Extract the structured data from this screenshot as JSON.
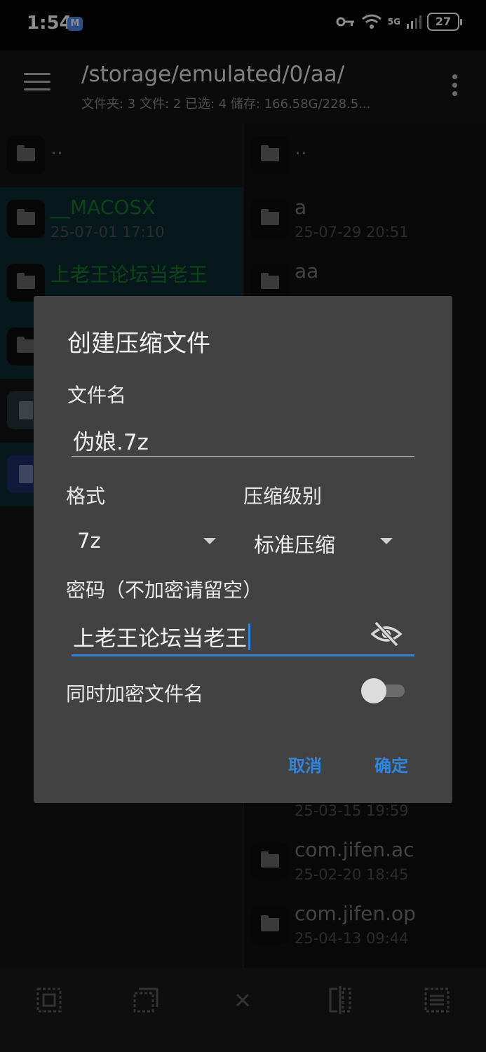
{
  "status": {
    "time": "1:54",
    "network": "5G",
    "battery": "27"
  },
  "appbar": {
    "path": "/storage/emulated/0/aa/",
    "subtitle": "文件夹: 3  文件: 2  已选: 4  储存: 166.58G/228.5..."
  },
  "left_pane": {
    "items": [
      {
        "name": "..",
        "date": ""
      },
      {
        "name": "__MACOSX",
        "date": "25-07-01 17:10"
      },
      {
        "name": "上老王论坛当老王",
        "date": ""
      },
      {
        "name": "",
        "date": ""
      },
      {
        "name": "",
        "date": ""
      },
      {
        "name": "",
        "date": ""
      }
    ]
  },
  "right_pane": {
    "items": [
      {
        "name": "..",
        "date": ""
      },
      {
        "name": "a",
        "date": "25-07-29 20:51"
      },
      {
        "name": "aa",
        "date": ""
      },
      {
        "name": "",
        "date": "25-03-15 19:59"
      },
      {
        "name": "com.jifen.ac",
        "date": "25-02-20 18:45"
      },
      {
        "name": "com.jifen.op",
        "date": "25-04-13 09:44"
      }
    ]
  },
  "dialog": {
    "title": "创建压缩文件",
    "filename_label": "文件名",
    "filename_value": "伪娘.7z",
    "format_label": "格式",
    "format_value": "7z",
    "level_label": "压缩级别",
    "level_value": "标准压缩",
    "password_label": "密码（不加密请留空）",
    "password_value": "上老王论坛当老王",
    "encrypt_names_label": "同时加密文件名",
    "encrypt_names_on": false,
    "cancel": "取消",
    "ok": "确定"
  },
  "colors": {
    "accent": "#2f86e0",
    "dialog_bg": "#424242",
    "selected_row": "#0e2c36",
    "green_name": "#1a7a2b"
  }
}
